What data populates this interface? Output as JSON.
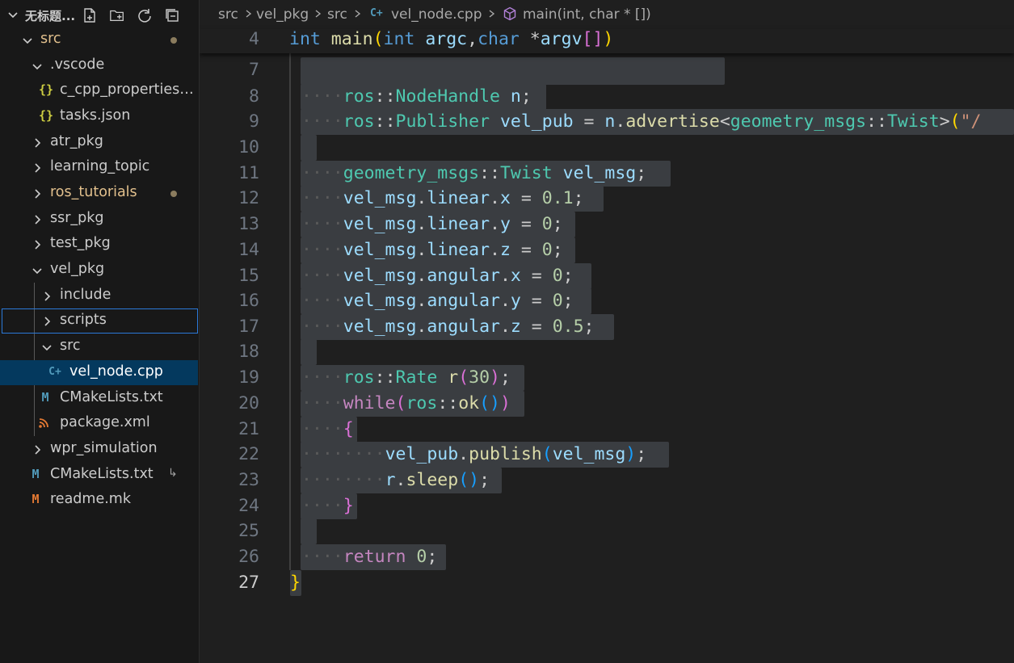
{
  "explorer": {
    "workspace_title": "无标题...",
    "tree": [
      {
        "label": "src",
        "badge": "dot"
      },
      {
        "label": ".vscode"
      },
      {
        "label": "c_cpp_properties....",
        "icon": "{}"
      },
      {
        "label": "tasks.json",
        "icon": "{}"
      },
      {
        "label": "atr_pkg"
      },
      {
        "label": "learning_topic"
      },
      {
        "label": "ros_tutorials",
        "badge": "dot"
      },
      {
        "label": "ssr_pkg"
      },
      {
        "label": "test_pkg"
      },
      {
        "label": "vel_pkg"
      },
      {
        "label": "include"
      },
      {
        "label": "scripts"
      },
      {
        "label": "src"
      },
      {
        "label": "vel_node.cpp",
        "icon": "C+"
      },
      {
        "label": "CMakeLists.txt",
        "icon": "M"
      },
      {
        "label": "package.xml",
        "icon": "rss"
      },
      {
        "label": "wpr_simulation"
      },
      {
        "label": "CMakeLists.txt",
        "icon": "M",
        "badge": "↳"
      },
      {
        "label": "readme.mk",
        "icon": "M"
      }
    ]
  },
  "breadcrumb": {
    "items": [
      "src",
      "vel_pkg",
      "src",
      "vel_node.cpp",
      "main(int, char * [])"
    ]
  },
  "editor": {
    "sticky": {
      "line": "4",
      "code": "int main(int argc,char *argv[])"
    },
    "lines": [
      {
        "n": "7",
        "code": ""
      },
      {
        "n": "8",
        "code": "    ros::NodeHandle n;"
      },
      {
        "n": "9",
        "code": "    ros::Publisher vel_pub = n.advertise<geometry_msgs::Twist>(\"/"
      },
      {
        "n": "10",
        "code": ""
      },
      {
        "n": "11",
        "code": "    geometry_msgs::Twist vel_msg;"
      },
      {
        "n": "12",
        "code": "    vel_msg.linear.x = 0.1;"
      },
      {
        "n": "13",
        "code": "    vel_msg.linear.y = 0;"
      },
      {
        "n": "14",
        "code": "    vel_msg.linear.z = 0;"
      },
      {
        "n": "15",
        "code": "    vel_msg.angular.x = 0;"
      },
      {
        "n": "16",
        "code": "    vel_msg.angular.y = 0;"
      },
      {
        "n": "17",
        "code": "    vel_msg.angular.z = 0.5;"
      },
      {
        "n": "18",
        "code": ""
      },
      {
        "n": "19",
        "code": "    ros::Rate r(30);"
      },
      {
        "n": "20",
        "code": "    while(ros::ok())"
      },
      {
        "n": "21",
        "code": "    {"
      },
      {
        "n": "22",
        "code": "        vel_pub.publish(vel_msg);"
      },
      {
        "n": "23",
        "code": "        r.sleep();"
      },
      {
        "n": "24",
        "code": "    }"
      },
      {
        "n": "25",
        "code": ""
      },
      {
        "n": "26",
        "code": "    return 0;"
      },
      {
        "n": "27",
        "code": "}"
      }
    ]
  },
  "colors": {
    "selection": "#3a3d41",
    "active_row": "#04395e",
    "focus_outline": "#2b79d8",
    "modified": "#e2c08d"
  }
}
